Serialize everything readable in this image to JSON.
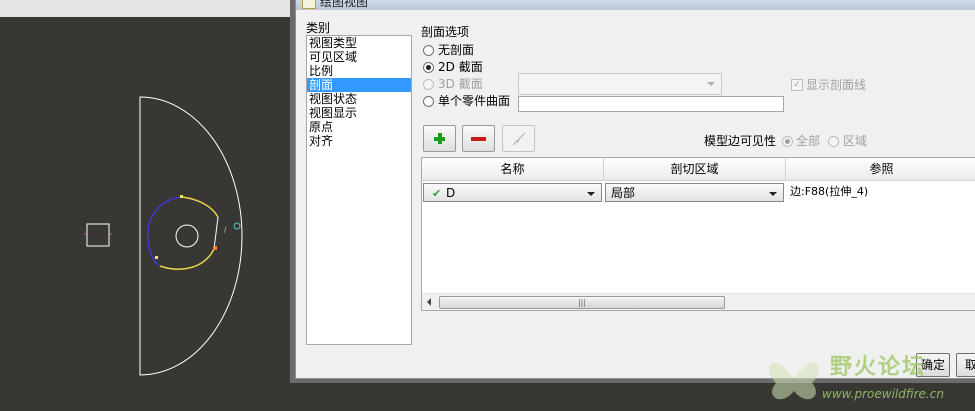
{
  "window": {
    "title": "绘图视图"
  },
  "categories": {
    "heading": "类别",
    "items": [
      {
        "label": "视图类型",
        "selected": false
      },
      {
        "label": "可见区域",
        "selected": false
      },
      {
        "label": "比例",
        "selected": false
      },
      {
        "label": "剖面",
        "selected": true
      },
      {
        "label": "视图状态",
        "selected": false
      },
      {
        "label": "视图显示",
        "selected": false
      },
      {
        "label": "原点",
        "selected": false
      },
      {
        "label": "对齐",
        "selected": false
      }
    ]
  },
  "section_options": {
    "heading": "剖面选项",
    "no_section": "无剖面",
    "section_2d": "2D 截面",
    "section_3d": "3D 截面",
    "single_part_surface": "单个零件曲面",
    "selected": "2D 截面",
    "section_3d_value": "",
    "single_part_value": "",
    "show_section_lines_label": "显示剖面线",
    "show_section_lines_checked": true
  },
  "toolbar": {
    "add_icon": "plus-icon",
    "remove_icon": "minus-icon",
    "arrow_icon": "arrow-icon",
    "model_edge_visibility_label": "模型边可见性",
    "visibility_all": "全部",
    "visibility_area": "区域",
    "visibility_selected": "全部"
  },
  "table": {
    "columns": [
      "名称",
      "剖切区域",
      "参照"
    ],
    "rows": [
      {
        "name": "D",
        "region": "局部",
        "reference": "边:F88(拉伸_4)"
      }
    ],
    "scroll_thumb": "|||"
  },
  "buttons": {
    "ok": "确定",
    "cancel": "取"
  },
  "watermark": {
    "text_cn": "野火论坛",
    "url": "www.proewildfire.cn"
  },
  "colors": {
    "viewport_bg": "#383734",
    "selection": "#3399ff",
    "curve_yellow": "#e8d44a",
    "curve_blue": "#3a3ad0"
  }
}
